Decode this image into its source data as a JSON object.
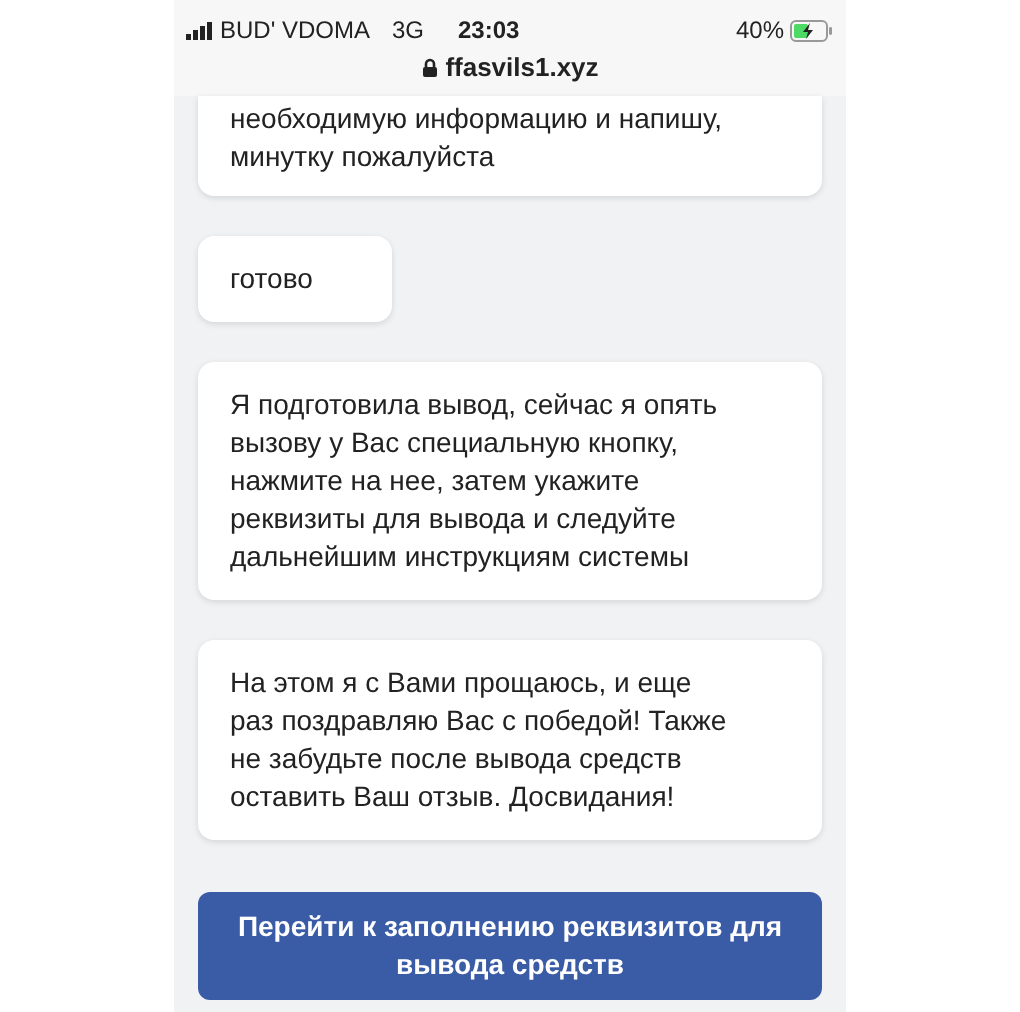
{
  "status_bar": {
    "carrier": "BUD' VDOMA",
    "network": "3G",
    "time": "23:03",
    "battery": "40%"
  },
  "address_bar": {
    "url": "ffasvils1.xyz"
  },
  "messages": [
    {
      "text": "необходимую информацию и напишу, минутку пожалуйста",
      "cut_top": true
    },
    {
      "text": "готово",
      "cut_top": false
    },
    {
      "text": "Я подготовила вывод, сейчас я опять вызову у Вас специальную кнопку, нажмите на нее, затем укажите реквизиты для вывода и следуйте дальнейшим инструкциям системы",
      "cut_top": false
    },
    {
      "text": "На этом я с Вами прощаюсь, и еще раз поздравляю Вас с победой! Также не забудьте после вывода средств оставить Ваш отзыв. Досвидания!",
      "cut_top": false
    }
  ],
  "action_button": {
    "label": "Перейти к заполнению реквизитов для вывода средств"
  }
}
